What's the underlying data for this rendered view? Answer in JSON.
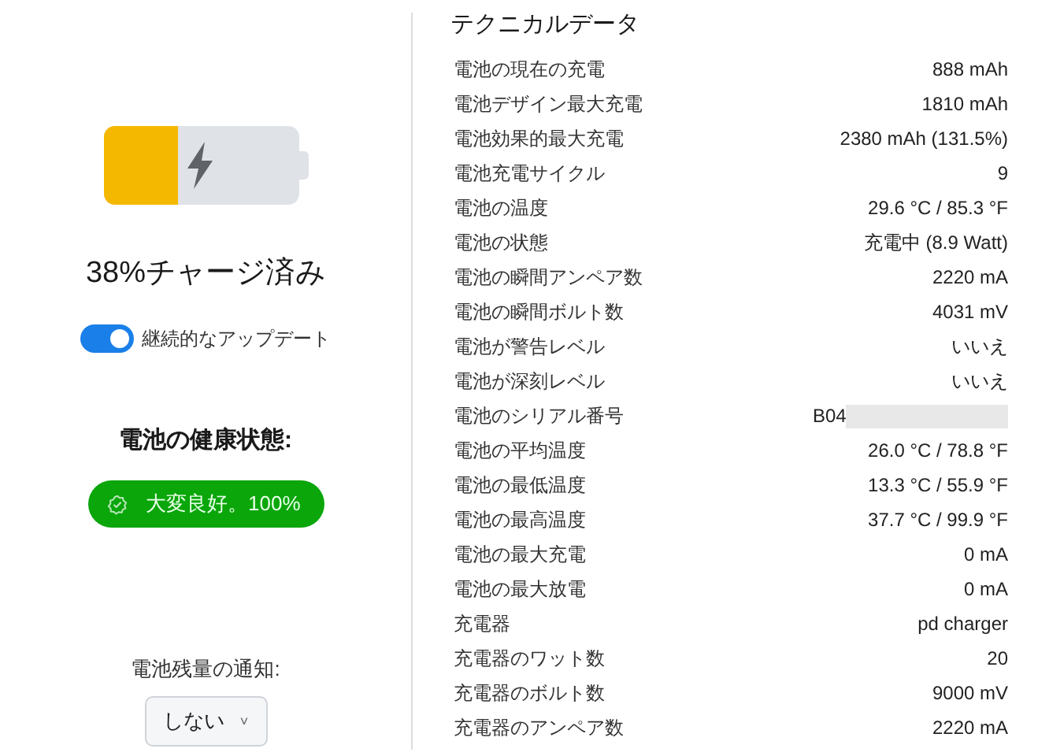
{
  "battery": {
    "level": 0.38,
    "charging": true,
    "caption": "38%チャージ済み"
  },
  "continuous_update": {
    "label": "継続的なアップデート",
    "on": true
  },
  "health": {
    "title": "電池の健康状態:",
    "badge": "大変良好。100%"
  },
  "notification": {
    "label": "電池残量の通知:",
    "value": "しない",
    "caret": "˅"
  },
  "technical": {
    "title": "テクニカルデータ",
    "rows": [
      {
        "label": "電池の現在の充電",
        "value": "888 mAh"
      },
      {
        "label": "電池デザイン最大充電",
        "value": "1810 mAh"
      },
      {
        "label": "電池効果的最大充電",
        "value": "2380 mAh (131.5%)"
      },
      {
        "label": "電池充電サイクル",
        "value": "9"
      },
      {
        "label": "電池の温度",
        "value": "29.6 °C / 85.3 °F"
      },
      {
        "label": "電池の状態",
        "value": "充電中 (8.9 Watt)"
      },
      {
        "label": "電池の瞬間アンペア数",
        "value": "2220 mA"
      },
      {
        "label": "電池の瞬間ボルト数",
        "value": "4031 mV"
      },
      {
        "label": "電池が警告レベル",
        "value": "いいえ"
      },
      {
        "label": "電池が深刻レベル",
        "value": "いいえ"
      },
      {
        "label": "電池のシリアル番号",
        "value": "B04",
        "kind": "redacted"
      },
      {
        "label": "電池の平均温度",
        "value": "26.0 °C / 78.8 °F"
      },
      {
        "label": "電池の最低温度",
        "value": "13.3 °C / 55.9 °F"
      },
      {
        "label": "電池の最高温度",
        "value": "37.7 °C / 99.9 °F"
      },
      {
        "label": "電池の最大充電",
        "value": "0 mA"
      },
      {
        "label": "電池の最大放電",
        "value": "0 mA"
      },
      {
        "label": "充電器",
        "value": "pd charger"
      },
      {
        "label": "充電器のワット数",
        "value": "20"
      },
      {
        "label": "充電器のボルト数",
        "value": "9000 mV"
      },
      {
        "label": "充電器のアンペア数",
        "value": "2220 mA"
      }
    ]
  }
}
